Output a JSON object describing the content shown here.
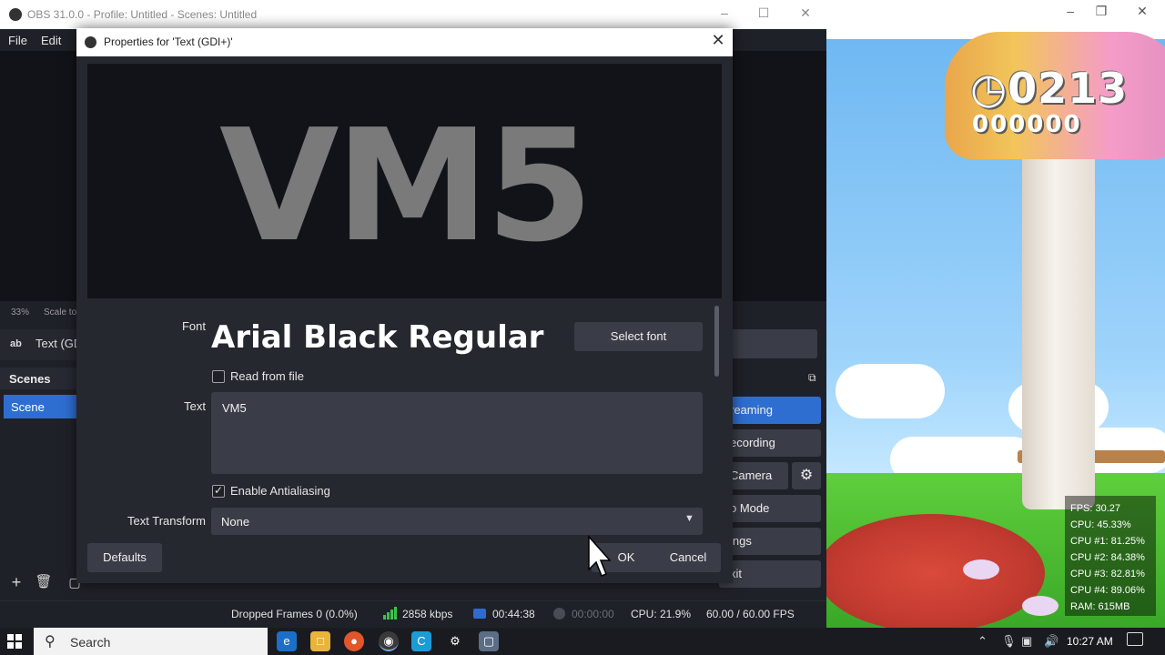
{
  "obs": {
    "window_title": "OBS 31.0.0 - Profile: Untitled - Scenes: Untitled",
    "menu": [
      "File",
      "Edit"
    ],
    "zoom_level": "33%",
    "scale_label": "Scale to",
    "source_icon": "ab",
    "source_name": "Text (GDI+)",
    "scenes_title": "Scenes",
    "scene_selected": "Scene",
    "controls": {
      "streaming": "reaming",
      "recording": "ecording",
      "camera": "Camera",
      "studio": "o Mode",
      "settings": "ings",
      "exit": "xit"
    },
    "status": {
      "dropped_frames": "Dropped Frames 0 (0.0%)",
      "bitrate": "2858 kbps",
      "rec_time": "00:44:38",
      "stream_time": "00:00:00",
      "cpu": "CPU: 21.9%",
      "fps": "60.00 / 60.00 FPS"
    }
  },
  "dialog": {
    "title": "Properties for 'Text (GDI+)'",
    "preview_text": "VM5",
    "font_label": "Font",
    "font_name": "Arial Black Regular",
    "select_font_button": "Select font",
    "read_from_file_label": "Read from file",
    "read_from_file_checked": false,
    "text_label": "Text",
    "text_value": "VM5",
    "antialiasing_label": "Enable Antialiasing",
    "antialiasing_checked": true,
    "transform_label": "Text Transform",
    "transform_value": "None",
    "defaults_button": "Defaults",
    "ok_button": "OK",
    "cancel_button": "Cancel"
  },
  "game": {
    "timer": "0213",
    "coins": "000000"
  },
  "stats_overlay": [
    "FPS: 30.27",
    "CPU: 45.33%",
    "CPU #1: 81.25%",
    "CPU #2: 84.38%",
    "CPU #3: 82.81%",
    "CPU #4: 89.06%",
    "RAM: 615MB"
  ],
  "taskbar": {
    "search_placeholder": "Search",
    "clock": "10:27 AM"
  },
  "colors": {
    "accent_blue": "#2e6ed1",
    "dialog_bg": "#262830",
    "signal_green": "#3cc24a"
  }
}
